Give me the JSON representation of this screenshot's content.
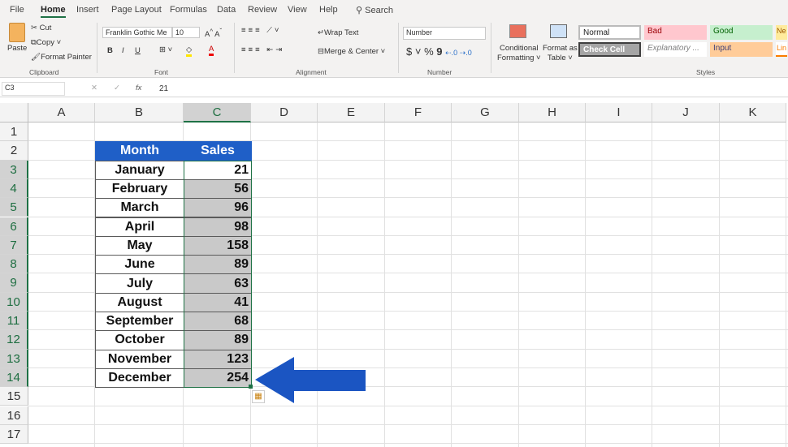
{
  "tabs": [
    "File",
    "Home",
    "Insert",
    "Page Layout",
    "Formulas",
    "Data",
    "Review",
    "View",
    "Help"
  ],
  "search_label": "Search",
  "ribbon": {
    "clipboard": {
      "paste": "Paste",
      "cut": "Cut",
      "copy": "Copy",
      "format_painter": "Format Painter",
      "group": "Clipboard"
    },
    "font": {
      "name": "Franklin Gothic Me",
      "size": "10",
      "group": "Font",
      "bold": "B",
      "italic": "I",
      "underline": "U"
    },
    "alignment": {
      "wrap_text": "Wrap Text",
      "merge_center": "Merge & Center",
      "group": "Alignment"
    },
    "number": {
      "format": "Number",
      "currency": "$",
      "percent": "%",
      "comma": "9",
      "group": "Number"
    },
    "styles": {
      "conditional": "Conditional",
      "formatting": "Formatting",
      "format_as": "Format as",
      "table": "Table",
      "group": "Styles",
      "items": [
        {
          "label": "Normal",
          "bg": "#ffffff",
          "fg": "#222222"
        },
        {
          "label": "Bad",
          "bg": "#ffc7ce",
          "fg": "#9c0006"
        },
        {
          "label": "Good",
          "bg": "#c6efce",
          "fg": "#006100"
        },
        {
          "label": "Ne",
          "bg": "#ffeb9c",
          "fg": "#9c5700"
        },
        {
          "label": "Check Cell",
          "bg": "#a5a5a5",
          "fg": "#ffffff"
        },
        {
          "label": "Explanatory ...",
          "bg": "#ffffff",
          "fg": "#7f7f7f"
        },
        {
          "label": "Input",
          "bg": "#ffcc99",
          "fg": "#3f3f76"
        },
        {
          "label": "Lin",
          "bg": "#ffffff",
          "fg": "#fa7d00"
        }
      ]
    }
  },
  "formula_bar": {
    "name_box": "C3",
    "fx": "fx",
    "value": "21"
  },
  "columns": [
    "A",
    "B",
    "C",
    "D",
    "E",
    "F",
    "G",
    "H",
    "I",
    "J",
    "K"
  ],
  "rows": [
    "1",
    "2",
    "3",
    "4",
    "5",
    "6",
    "7",
    "8",
    "9",
    "10",
    "11",
    "12",
    "13",
    "14",
    "15",
    "16",
    "17"
  ],
  "table": {
    "headers": [
      "Month",
      "Sales"
    ],
    "months": [
      "January",
      "February",
      "March",
      "April",
      "May",
      "June",
      "July",
      "August",
      "September",
      "October",
      "November",
      "December"
    ],
    "sales": [
      "21",
      "56",
      "96",
      "98",
      "158",
      "89",
      "63",
      "41",
      "68",
      "89",
      "123",
      "254"
    ]
  },
  "colors": {
    "header_bg": "#1f5fc7",
    "arrow": "#1b55c2",
    "selection": "#c9c9c9",
    "accent": "#1e7145"
  }
}
